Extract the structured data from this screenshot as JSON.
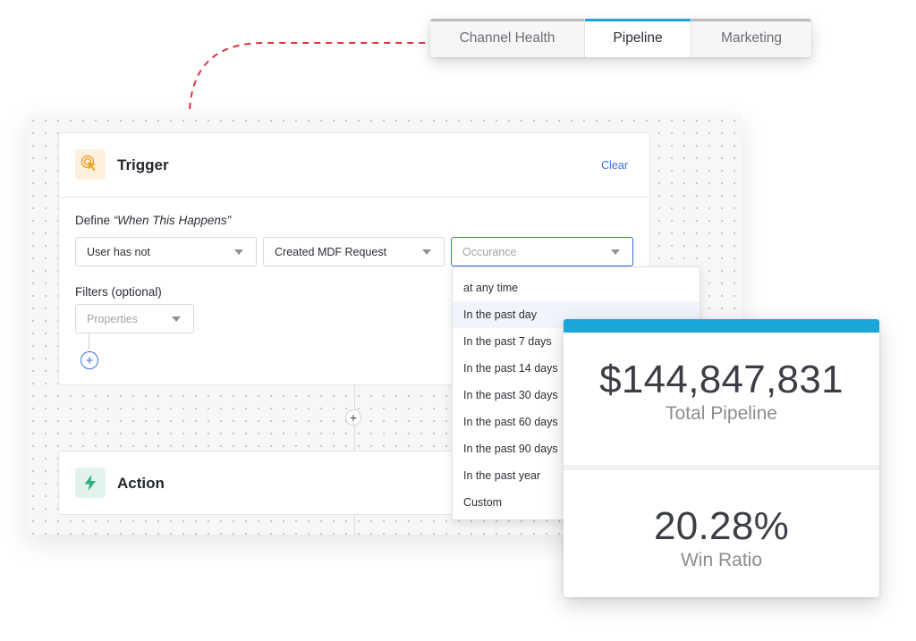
{
  "tabs": [
    {
      "label": "Channel Health"
    },
    {
      "label": "Pipeline"
    },
    {
      "label": "Marketing"
    }
  ],
  "trigger": {
    "title": "Trigger",
    "clear": "Clear",
    "define_prefix": "Define ",
    "define_quote": "“When This Happens”",
    "select_1": "User has not",
    "select_2": "Created MDF Request",
    "select_3_placeholder": "Occurance",
    "filters_label": "Filters (optional)",
    "properties_placeholder": "Properties"
  },
  "action": {
    "title": "Action"
  },
  "dropdown": {
    "items": [
      "at any time",
      "In the past day",
      "In the past 7 days",
      "In the past 14 days",
      "In the past 30 days",
      "In the past 60 days",
      "In the past 90 days",
      "In the past year",
      "Custom"
    ]
  },
  "stats": {
    "pipeline_value": "$144,847,831",
    "pipeline_label": "Total Pipeline",
    "win_value": "20.28%",
    "win_label": "Win Ratio"
  },
  "colors": {
    "accent_blue": "#1aa6d8",
    "link_blue": "#3b73d9",
    "connector_red": "#e0343a",
    "trigger_icon": "#f0a22b",
    "action_icon": "#2fae7a"
  }
}
